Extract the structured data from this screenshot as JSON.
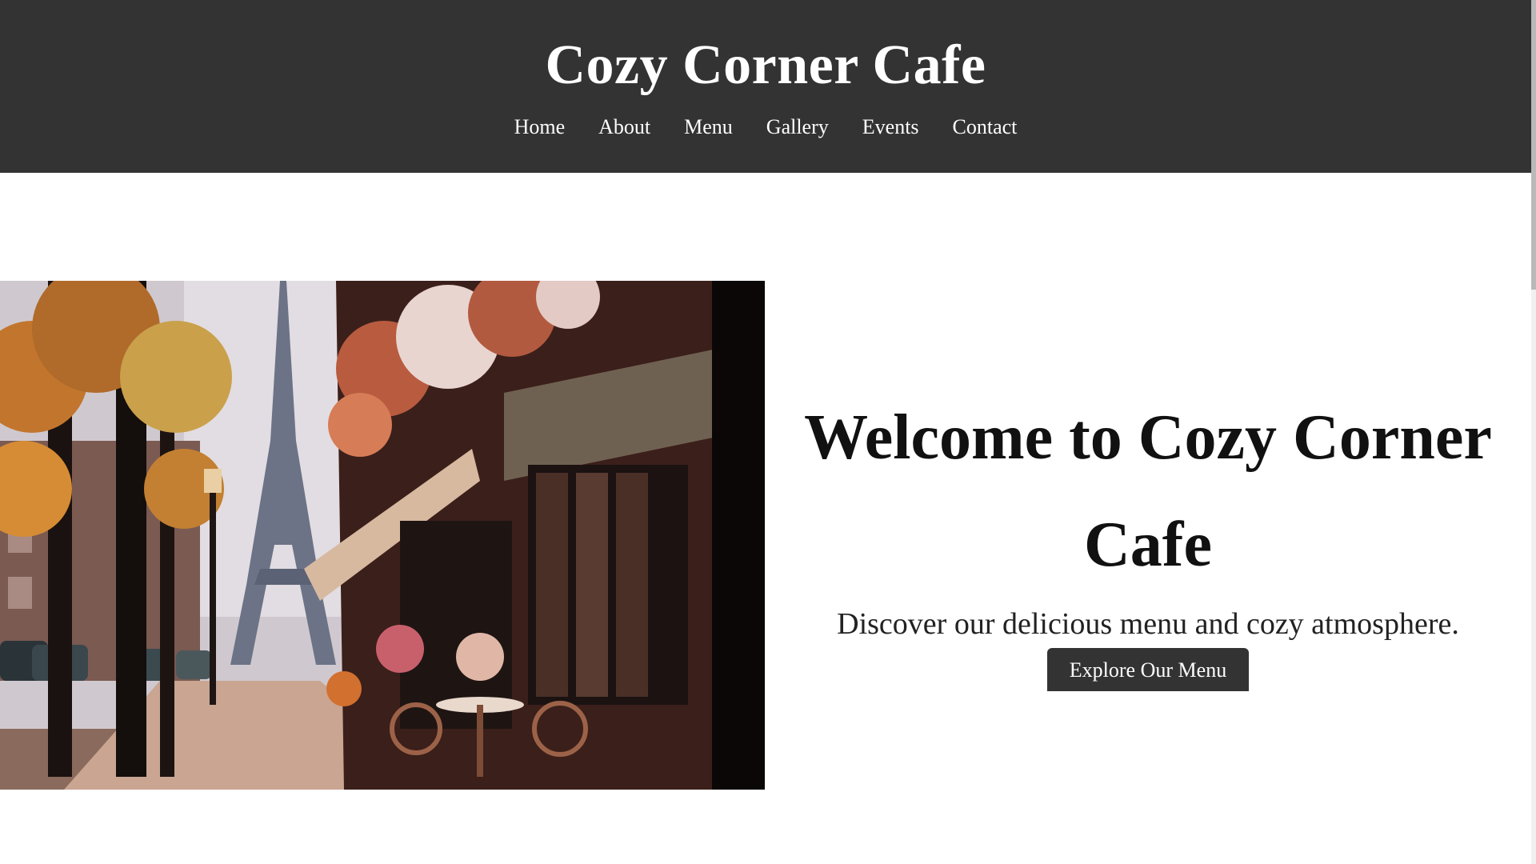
{
  "header": {
    "title": "Cozy Corner Cafe",
    "nav": [
      "Home",
      "About",
      "Menu",
      "Gallery",
      "Events",
      "Contact"
    ]
  },
  "hero": {
    "heading": "Welcome to Cozy Corner Cafe",
    "subheading": "Discover our delicious menu and cozy atmosphere.",
    "button_label": "Explore Our Menu"
  },
  "colors": {
    "header_bg": "#333333",
    "button_bg": "#333333",
    "page_bg": "#ffffff"
  }
}
